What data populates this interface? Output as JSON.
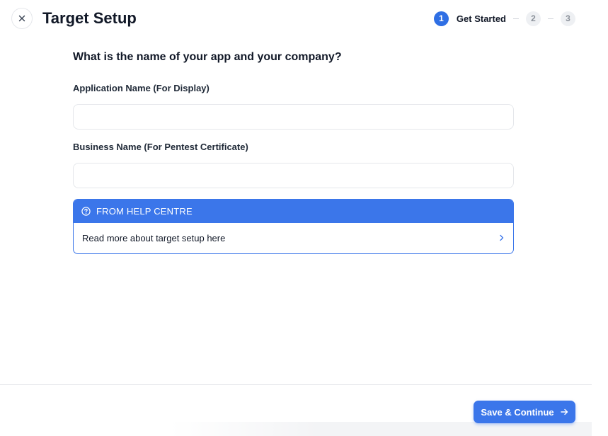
{
  "header": {
    "title": "Target Setup",
    "close_icon": "close-icon"
  },
  "stepper": {
    "steps": [
      {
        "number": "1",
        "label": "Get Started",
        "active": true
      },
      {
        "number": "2",
        "label": "",
        "active": false
      },
      {
        "number": "3",
        "label": "",
        "active": false
      }
    ]
  },
  "form": {
    "question": "What is the name of your app and your company?",
    "app_name_label": "Application Name (For Display)",
    "app_name_value": "",
    "business_name_label": "Business Name (For Pentest Certificate)",
    "business_name_value": ""
  },
  "help": {
    "header": "FROM HELP CENTRE",
    "link_text": "Read more about target setup here",
    "header_icon": "help-circle-icon",
    "link_icon": "chevron-right-icon"
  },
  "footer": {
    "save_label": "Save & Continue",
    "save_icon": "arrow-right-icon"
  },
  "colors": {
    "accent": "#3b76ea",
    "step_active": "#2f6fe4",
    "step_inactive_bg": "#eef0f3"
  }
}
